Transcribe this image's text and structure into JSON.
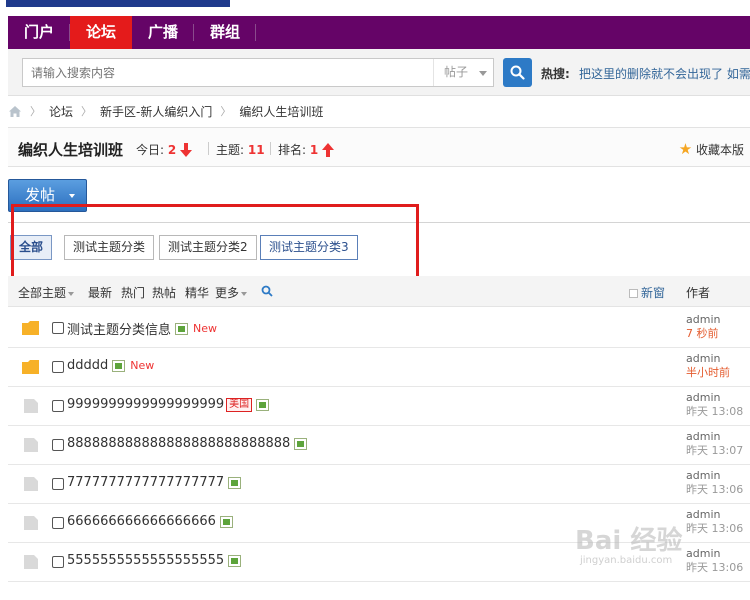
{
  "nav": {
    "items": [
      {
        "label": "门户"
      },
      {
        "label": "论坛"
      },
      {
        "label": "广播"
      },
      {
        "label": "群组"
      }
    ]
  },
  "search": {
    "placeholder": "请输入搜索内容",
    "type": "帖子",
    "hot_label": "热搜:",
    "hot_link": "把这里的删除就不会出现了 如需"
  },
  "breadcrumb": [
    "论坛",
    "新手区-新人编织入门",
    "编织人生培训班"
  ],
  "forum": {
    "title": "编织人生培训班",
    "today_label": "今日:",
    "today_value": "2",
    "topics_label": "主题:",
    "topics_value": "11",
    "rank_label": "排名:",
    "rank_value": "1",
    "favorite": "收藏本版"
  },
  "post_button": "发帖",
  "categories": [
    "全部",
    "测试主题分类",
    "测试主题分类2",
    "测试主题分类3"
  ],
  "list_header": {
    "all_topics": "全部主题",
    "filters": [
      "最新",
      "热门",
      "热帖",
      "精华",
      "更多"
    ],
    "new_window": "新窗",
    "author": "作者"
  },
  "threads": [
    {
      "title": "测试主题分类信息",
      "new": "New",
      "author": "admin",
      "time": "7 秒前"
    },
    {
      "title": "ddddd",
      "new": "New",
      "author": "admin",
      "time": "半小时前"
    },
    {
      "title": "9999999999999999999",
      "tag": "美国",
      "author": "admin",
      "time": "昨天 13:08"
    },
    {
      "title": "888888888888888888888888888",
      "author": "admin",
      "time": "昨天 13:07"
    },
    {
      "title": "7777777777777777777",
      "author": "admin",
      "time": "昨天 13:06"
    },
    {
      "title": "666666666666666666",
      "author": "admin",
      "time": "昨天 13:06"
    },
    {
      "title": "5555555555555555555",
      "author": "admin",
      "time": "昨天 13:06"
    }
  ],
  "watermark": "Bai 经验",
  "watermark_sub": "jingyan.baidu.com",
  "colors": {
    "nav_bg": "#650467",
    "nav_active": "#e41b1b",
    "highlight_box": "#e01c1c",
    "button": "#2c6fbe"
  }
}
